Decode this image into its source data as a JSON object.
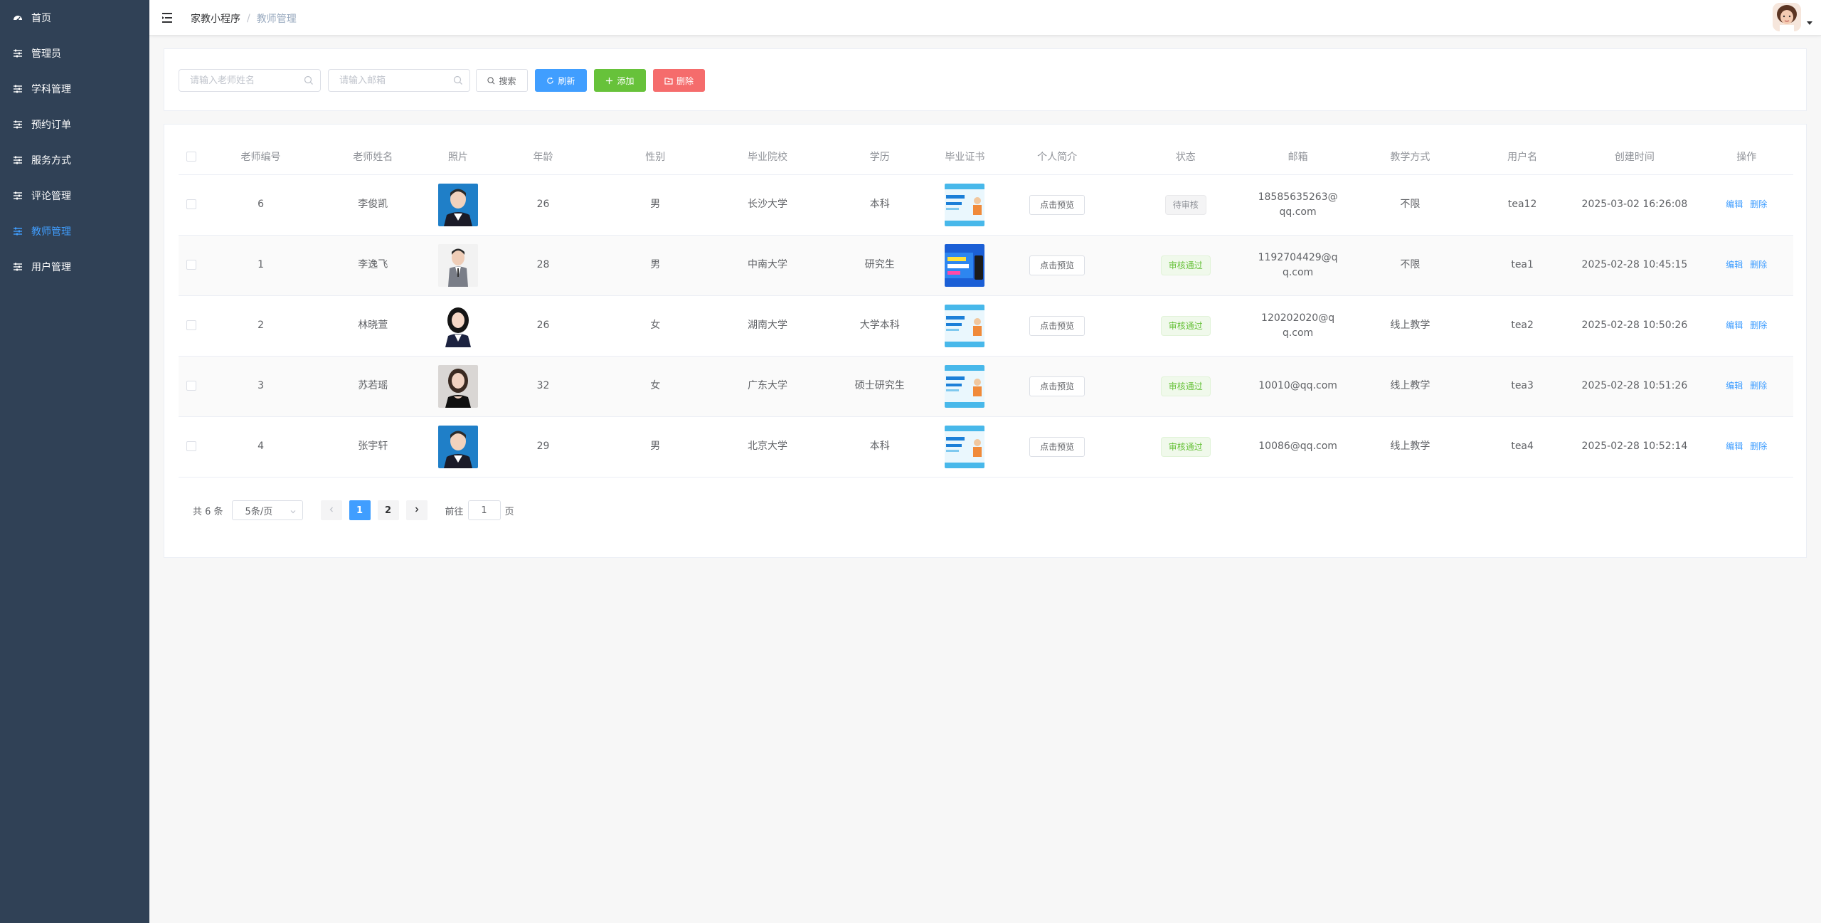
{
  "sidebar": {
    "items": [
      {
        "label": "首页",
        "icon": "dashboard-icon",
        "active": false
      },
      {
        "label": "管理员",
        "icon": "sliders-icon",
        "active": false
      },
      {
        "label": "学科管理",
        "icon": "sliders-icon",
        "active": false
      },
      {
        "label": "预约订单",
        "icon": "sliders-icon",
        "active": false
      },
      {
        "label": "服务方式",
        "icon": "sliders-icon",
        "active": false
      },
      {
        "label": "评论管理",
        "icon": "sliders-icon",
        "active": false
      },
      {
        "label": "教师管理",
        "icon": "sliders-icon",
        "active": true
      },
      {
        "label": "用户管理",
        "icon": "sliders-icon",
        "active": false
      }
    ]
  },
  "header": {
    "breadcrumb": [
      "家教小程序",
      "教师管理"
    ],
    "separator": "/"
  },
  "search": {
    "name_placeholder": "请输入老师姓名",
    "email_placeholder": "请输入邮箱",
    "search_label": "搜索",
    "refresh_label": "刷新",
    "add_label": "添加",
    "delete_label": "删除"
  },
  "table": {
    "columns": [
      "老师编号",
      "老师姓名",
      "照片",
      "年龄",
      "性别",
      "毕业院校",
      "学历",
      "毕业证书",
      "个人简介",
      "状态",
      "邮箱",
      "教学方式",
      "用户名",
      "创建时间",
      "操作"
    ],
    "preview_label": "点击预览",
    "edit_label": "编辑",
    "delete_label": "删除",
    "rows": [
      {
        "id": "6",
        "name": "李俊凯",
        "age": "26",
        "gender": "男",
        "school": "长沙大学",
        "degree": "本科",
        "status": "待审核",
        "status_type": "pending",
        "email": "18585635263@qq.com",
        "mode": "不限",
        "username": "tea12",
        "created": "2025-03-02 16:26:08",
        "photo": "boy-blue",
        "cert": "light"
      },
      {
        "id": "1",
        "name": "李逸飞",
        "age": "28",
        "gender": "男",
        "school": "中南大学",
        "degree": "研究生",
        "status": "审核通过",
        "status_type": "passed",
        "email": "1192704429@qq.com",
        "mode": "不限",
        "username": "tea1",
        "created": "2025-02-28 10:45:15",
        "photo": "man-suit",
        "cert": "dark"
      },
      {
        "id": "2",
        "name": "林晓萱",
        "age": "26",
        "gender": "女",
        "school": "湖南大学",
        "degree": "大学本科",
        "status": "审核通过",
        "status_type": "passed",
        "email": "120202020@qq.com",
        "mode": "线上教学",
        "username": "tea2",
        "created": "2025-02-28 10:50:26",
        "photo": "girl-white",
        "cert": "light"
      },
      {
        "id": "3",
        "name": "苏若瑶",
        "age": "32",
        "gender": "女",
        "school": "广东大学",
        "degree": "硕士研究生",
        "status": "审核通过",
        "status_type": "passed",
        "email": "10010@qq.com",
        "mode": "线上教学",
        "username": "tea3",
        "created": "2025-02-28 10:51:26",
        "photo": "woman-grey",
        "cert": "light"
      },
      {
        "id": "4",
        "name": "张宇轩",
        "age": "29",
        "gender": "男",
        "school": "北京大学",
        "degree": "本科",
        "status": "审核通过",
        "status_type": "passed",
        "email": "10086@qq.com",
        "mode": "线上教学",
        "username": "tea4",
        "created": "2025-02-28 10:52:14",
        "photo": "boy-blue",
        "cert": "light"
      }
    ]
  },
  "pagination": {
    "total_label": "共 6 条",
    "page_size": "5条/页",
    "pages": [
      "1",
      "2"
    ],
    "current": "1",
    "goto_prefix": "前往",
    "goto_value": "1",
    "goto_suffix": "页"
  },
  "colors": {
    "sidebar_bg": "#304156",
    "primary": "#409eff",
    "success": "#67c23a",
    "danger": "#f56c6c"
  }
}
